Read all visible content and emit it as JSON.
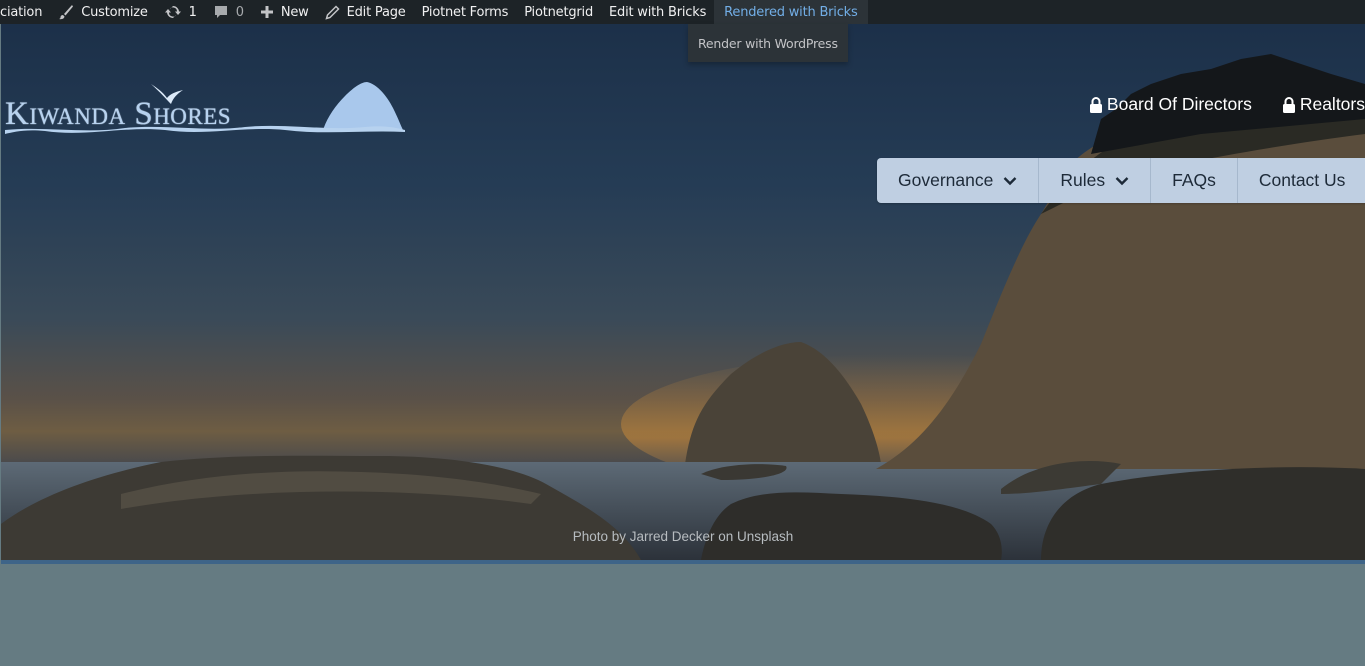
{
  "admin_bar": {
    "site_name": "ciation",
    "customize": "Customize",
    "updates_count": "1",
    "comments_count": "0",
    "new": "New",
    "edit_page": "Edit Page",
    "piotnet_forms": "Piotnet Forms",
    "piotnetgrid": "Piotnetgrid",
    "edit_with_bricks": "Edit with Bricks",
    "rendered_with_bricks": "Rendered with Bricks",
    "dropdown": {
      "render_with_wordpress": "Render with WordPress"
    }
  },
  "header": {
    "logo_text": "Kiwanda Shores",
    "top_links": [
      "Board Of Directors",
      "Realtors"
    ],
    "nav": [
      {
        "label": "Governance",
        "has_dropdown": true
      },
      {
        "label": "Rules",
        "has_dropdown": true
      },
      {
        "label": "FAQs",
        "has_dropdown": false
      },
      {
        "label": "Contact Us",
        "has_dropdown": false
      }
    ]
  },
  "hero": {
    "photo_credit": "Photo by Jarred Decker on Unsplash"
  },
  "colors": {
    "admin_bar_bg": "#1d2327",
    "admin_bar_active": "#72aee6",
    "nav_bg": "#bfcfe2",
    "content_bg": "#657b82",
    "hero_border": "#3e6488"
  }
}
